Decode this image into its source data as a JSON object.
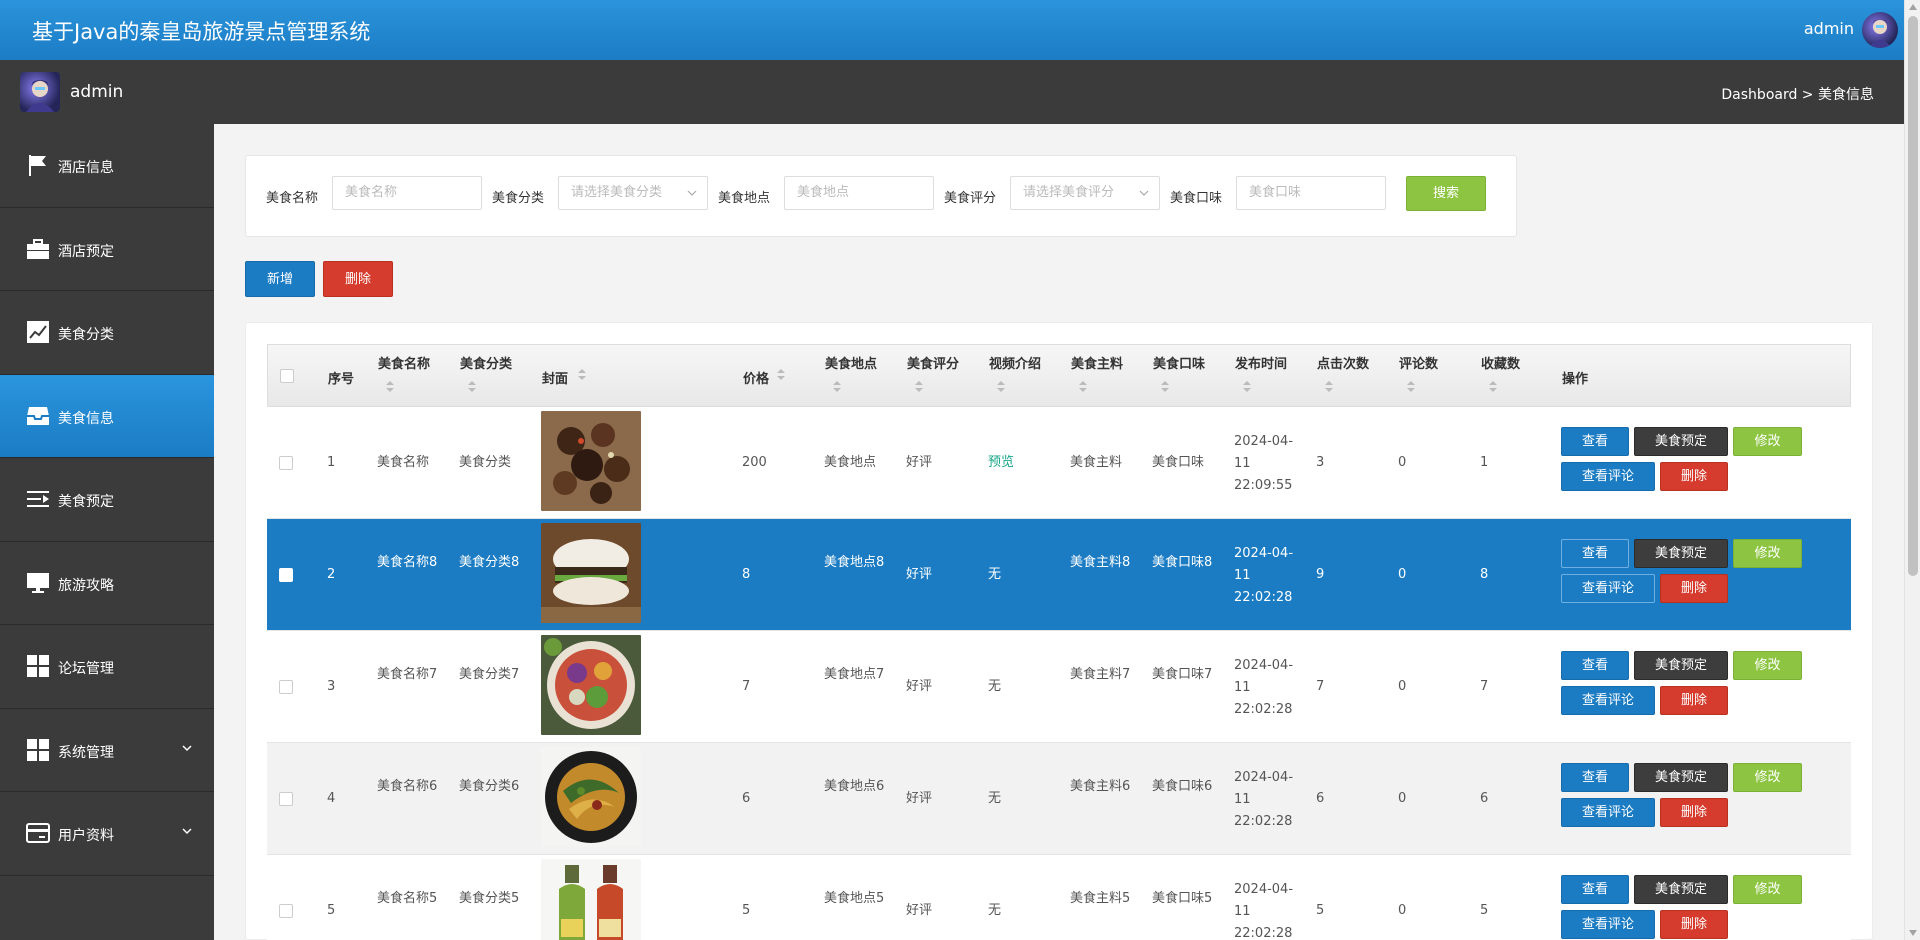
{
  "app": {
    "title": "基于Java的秦皇岛旅游景点管理系统",
    "user": "admin"
  },
  "subbar": {
    "name": "admin",
    "breadcrumb": "Dashboard > 美食信息"
  },
  "sidebar": {
    "items": [
      {
        "label": "酒店信息",
        "icon": "flag-icon"
      },
      {
        "label": "酒店预定",
        "icon": "briefcase-icon"
      },
      {
        "label": "美食分类",
        "icon": "line-chart-icon"
      },
      {
        "label": "美食信息",
        "icon": "inbox-icon",
        "active": true
      },
      {
        "label": "美食预定",
        "icon": "indent-icon"
      },
      {
        "label": "旅游攻略",
        "icon": "monitor-icon"
      },
      {
        "label": "论坛管理",
        "icon": "grid-icon"
      },
      {
        "label": "系统管理",
        "icon": "grid-icon",
        "expandable": true
      },
      {
        "label": "用户资料",
        "icon": "card-icon",
        "expandable": true
      }
    ]
  },
  "search": {
    "name_label": "美食名称",
    "name_placeholder": "美食名称",
    "category_label": "美食分类",
    "category_placeholder": "请选择美食分类",
    "location_label": "美食地点",
    "location_placeholder": "美食地点",
    "rating_label": "美食评分",
    "rating_placeholder": "请选择美食评分",
    "taste_label": "美食口味",
    "taste_placeholder": "美食口味",
    "button": "搜索"
  },
  "toolbar": {
    "add": "新增",
    "delete": "删除"
  },
  "table": {
    "headers": {
      "index": "序号",
      "name": "美食名称",
      "category": "美食分类",
      "cover": "封面",
      "price": "价格",
      "location": "美食地点",
      "rating": "美食评分",
      "video": "视频介绍",
      "ingredient": "美食主料",
      "taste": "美食口味",
      "published": "发布时间",
      "clicks": "点击次数",
      "comments": "评论数",
      "favorites": "收藏数",
      "actions": "操作"
    },
    "actions": {
      "view": "查看",
      "book": "美食预定",
      "edit": "修改",
      "comments": "查看评论",
      "delete": "删除"
    },
    "rows": [
      {
        "index": "1",
        "name": "美食名称",
        "category": "美食分类",
        "price": "200",
        "location": "美食地点",
        "rating": "好评",
        "video": "预览",
        "ingredient": "美食主料",
        "taste": "美食口味",
        "published": "2024-04-11 22:09:55",
        "clicks": "3",
        "comments": "0",
        "favorites": "1"
      },
      {
        "index": "2",
        "name": "美食名称8",
        "category": "美食分类8",
        "price": "8",
        "location": "美食地点8",
        "rating": "好评",
        "video": "无",
        "ingredient": "美食主料8",
        "taste": "美食口味8",
        "published": "2024-04-11 22:02:28",
        "clicks": "9",
        "comments": "0",
        "favorites": "8"
      },
      {
        "index": "3",
        "name": "美食名称7",
        "category": "美食分类7",
        "price": "7",
        "location": "美食地点7",
        "rating": "好评",
        "video": "无",
        "ingredient": "美食主料7",
        "taste": "美食口味7",
        "published": "2024-04-11 22:02:28",
        "clicks": "7",
        "comments": "0",
        "favorites": "7"
      },
      {
        "index": "4",
        "name": "美食名称6",
        "category": "美食分类6",
        "price": "6",
        "location": "美食地点6",
        "rating": "好评",
        "video": "无",
        "ingredient": "美食主料6",
        "taste": "美食口味6",
        "published": "2024-04-11 22:02:28",
        "clicks": "6",
        "comments": "0",
        "favorites": "6"
      },
      {
        "index": "5",
        "name": "美食名称5",
        "category": "美食分类5",
        "price": "5",
        "location": "美食地点5",
        "rating": "好评",
        "video": "无",
        "ingredient": "美食主料5",
        "taste": "美食口味5",
        "published": "2024-04-11 22:02:28",
        "clicks": "5",
        "comments": "0",
        "favorites": "5"
      }
    ]
  },
  "colors": {
    "primary": "#1b7cc4",
    "success": "#8dc543",
    "danger": "#d63c2d",
    "dark": "#3b3b3b"
  }
}
